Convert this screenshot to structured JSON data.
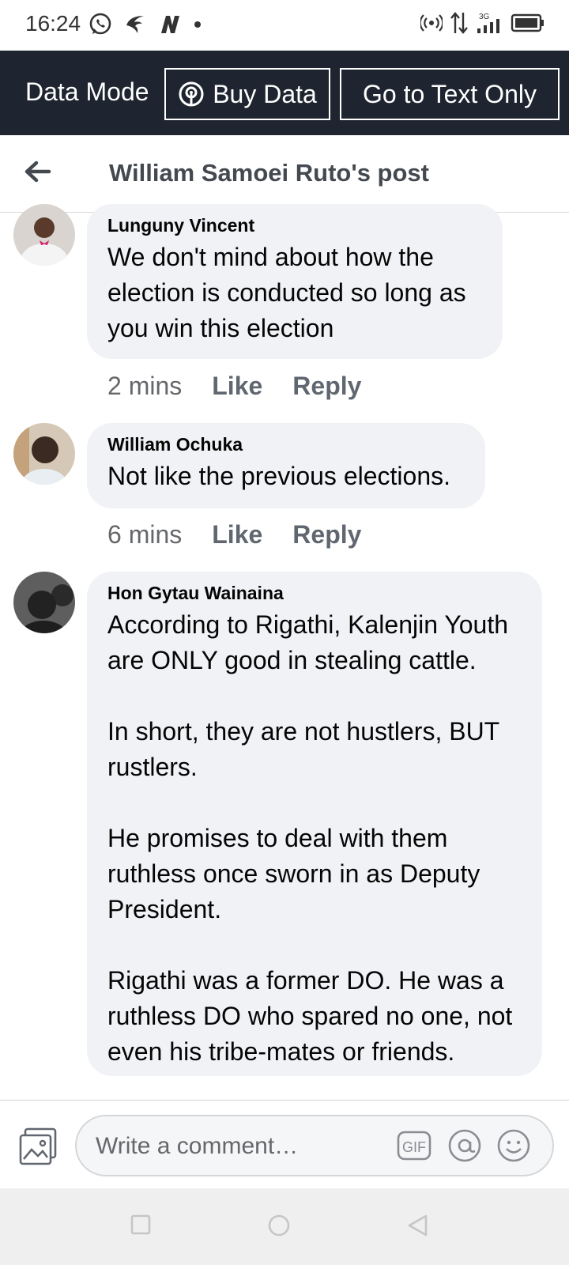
{
  "status": {
    "time": "16:24"
  },
  "databar": {
    "mode_label": "Data Mode",
    "buy_label": "Buy Data",
    "text_only_label": "Go to Text Only"
  },
  "header": {
    "title": "William Samoei Ruto's post"
  },
  "comments": [
    {
      "author": "Lunguny Vincent",
      "text": "We don't mind about how the election is conducted so long as you win this election",
      "time": "2 mins",
      "like": "Like",
      "reply": "Reply"
    },
    {
      "author": "William Ochuka",
      "text": "Not like the previous elections.",
      "time": "6 mins",
      "like": "Like",
      "reply": "Reply"
    },
    {
      "author": "Hon Gytau Wainaina",
      "text": "According to Rigathi, Kalenjin Youth are ONLY good in stealing cattle.\n\nIn short, they are not hustlers, BUT rustlers.\n\nHe promises to deal with them ruthless once sworn in as Deputy President.\n\nRigathi was a former DO. He was a ruthless DO who spared no one, not even his tribe-mates or friends."
    }
  ],
  "composer": {
    "placeholder": "Write a comment…",
    "gif_label": "GIF"
  }
}
